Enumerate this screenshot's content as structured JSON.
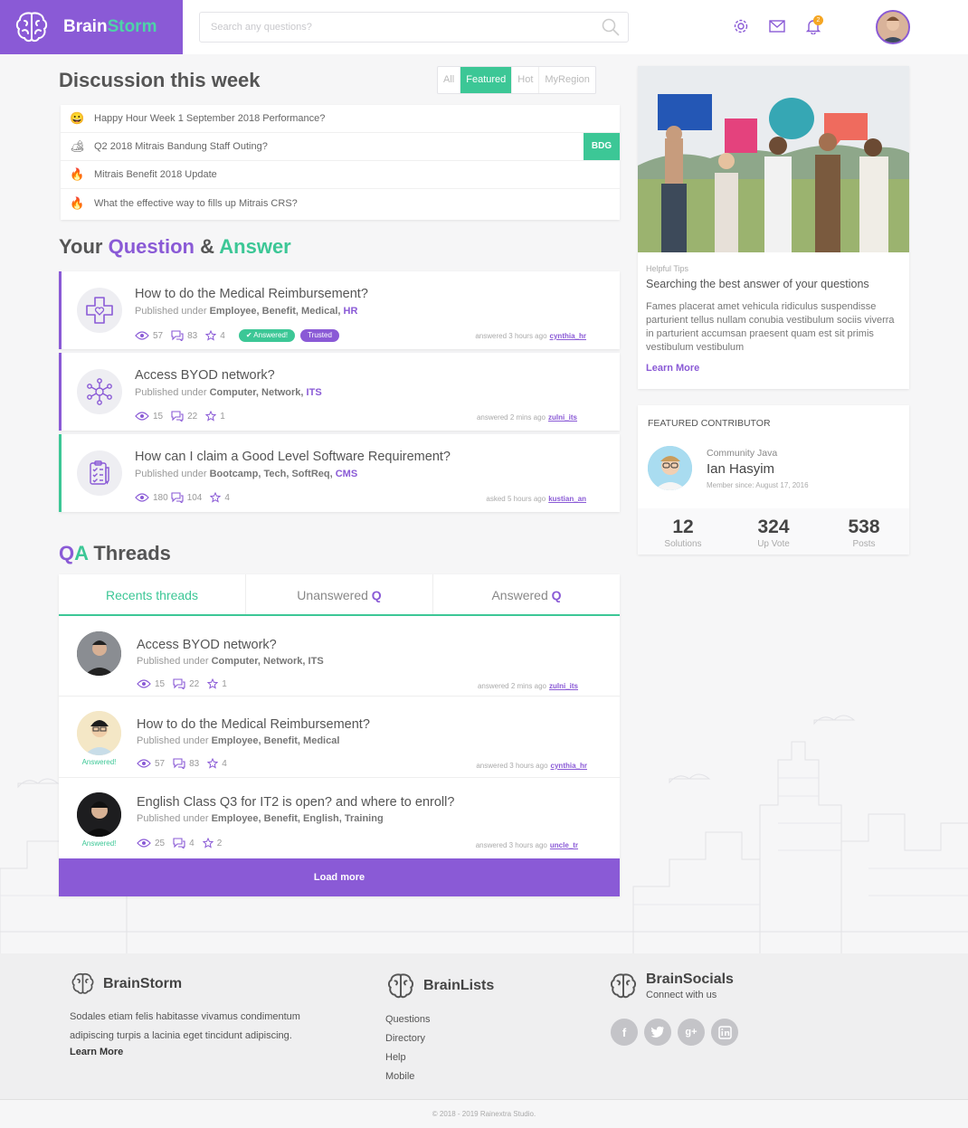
{
  "brand": {
    "name_part1": "Brain",
    "name_part2": "Storm",
    "accent": "#8a5ad6",
    "green": "#3cc796"
  },
  "search": {
    "placeholder": "Search any questions?"
  },
  "header": {
    "notification_count": "2"
  },
  "discussion": {
    "title": "Discussion this week",
    "filters": [
      "All",
      "Featured",
      "Hot",
      "MyRegion"
    ],
    "active_filter": "Featured",
    "items": [
      {
        "emoji": "😀",
        "text": "Happy Hour Week 1 September 2018 Performance?",
        "tag": ""
      },
      {
        "emoji": "🏕",
        "text": "Q2 2018 Mitrais Bandung Staff Outing?",
        "tag": "BDG"
      },
      {
        "emoji": "🔥",
        "text": "Mitrais Benefit 2018 Update",
        "tag": ""
      },
      {
        "emoji": "🔥",
        "text": "What the effective way to fills up Mitrais CRS?",
        "tag": ""
      }
    ]
  },
  "qa_section": {
    "your": "Your",
    "question": "Question",
    "amp": "&",
    "answer": "Answer"
  },
  "questions": [
    {
      "title": "How to do the Medical Reimbursement?",
      "prefix": "Published under",
      "cats": "Employee, Benefit, Medical,",
      "link": "HR",
      "views": "57",
      "comments": "83",
      "stars": "4",
      "badge1": "Answered!",
      "badge2": "Trusted",
      "meta": "answered 3 hours ago",
      "user": "cynthia_hr",
      "icon": "medical-cross-icon"
    },
    {
      "title": "Access BYOD network?",
      "prefix": "Published under",
      "cats": "Computer, Network,",
      "link": "ITS",
      "views": "15",
      "comments": "22",
      "stars": "1",
      "meta": "answered 2 mins ago",
      "user": "zulni_its",
      "icon": "network-icon"
    },
    {
      "title": "How can I claim a Good Level Software Requirement?",
      "prefix": "Published under",
      "cats": "Bootcamp, Tech, SoftReq,",
      "link": "CMS",
      "views": "180",
      "comments": "104",
      "stars": "4",
      "meta": "asked 5 hours ago",
      "user": "kustian_an",
      "icon": "checklist-icon"
    }
  ],
  "threads": {
    "title_q": "Q",
    "title_a": "A",
    "title_rest": "Threads",
    "tabs": [
      {
        "label": "Recents threads",
        "q": ""
      },
      {
        "label": "Unanswered",
        "q": "Q"
      },
      {
        "label": "Answered",
        "q": "Q"
      }
    ],
    "items": [
      {
        "title": "Access BYOD network?",
        "prefix": "Published under",
        "cats": "Computer, Network, ITS",
        "views": "15",
        "comments": "22",
        "stars": "1",
        "meta": "answered 2 mins ago",
        "user": "zulni_its",
        "answered": ""
      },
      {
        "title": "How to do the Medical Reimbursement?",
        "prefix": "Published under",
        "cats": "Employee, Benefit, Medical",
        "views": "57",
        "comments": "83",
        "stars": "4",
        "meta": "answered 3 hours ago",
        "user": "cynthia_hr",
        "answered": "Answered!"
      },
      {
        "title": "English Class Q3 for IT2 is open? and where to enroll?",
        "prefix": "Published under",
        "cats": "Employee, Benefit, English, Training",
        "views": "25",
        "comments": "4",
        "stars": "2",
        "meta": "answered 3 hours ago",
        "user": "uncle_tr",
        "answered": "Answered!"
      }
    ],
    "load_more": "Load more"
  },
  "tips": {
    "label": "Helpful Tips",
    "title": "Searching the best answer of your questions",
    "body": "Fames placerat amet vehicula ridiculus suspendisse parturient tellus nullam conubia vestibulum sociis viverra in parturient accumsan praesent quam est sit primis vestibulum vestibulum",
    "link": "Learn More"
  },
  "featured": {
    "heading": "FEATURED CONTRIBUTOR",
    "community": "Community Java",
    "name": "Ian Hasyim",
    "since": "Member since: August 17, 2016",
    "stats": [
      {
        "n": "12",
        "l": "Solutions"
      },
      {
        "n": "324",
        "l": "Up Vote"
      },
      {
        "n": "538",
        "l": "Posts"
      }
    ]
  },
  "footer": {
    "col1": {
      "title": "BrainStorm",
      "desc": "Sodales etiam felis habitasse vivamus condimentum adipiscing turpis a lacinia eget tincidunt adipiscing.",
      "link": "Learn More"
    },
    "col2": {
      "title": "BrainLists",
      "items": [
        "Questions",
        "Directory",
        "Help",
        "Mobile"
      ]
    },
    "col3": {
      "title": "BrainSocials",
      "sub": "Connect with us",
      "icons": [
        "facebook-icon",
        "twitter-icon",
        "google-plus-icon",
        "linkedin-icon"
      ]
    },
    "copyright": "© 2018 - 2019 Rainextra Studio."
  }
}
